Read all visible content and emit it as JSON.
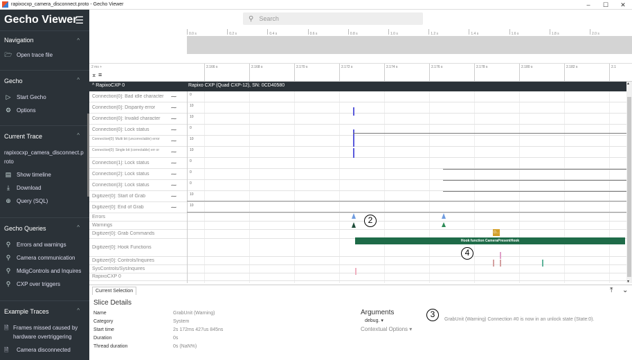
{
  "window": {
    "title": "rapixocxp_camera_disconnect.proto - Gecho Viewer",
    "minimize": "–",
    "maximize": "☐",
    "close": "✕"
  },
  "sidebar": {
    "brand": "Gecho Viewer",
    "sections": {
      "navigation": {
        "title": "Navigation",
        "items": [
          {
            "label": "Open trace file",
            "icon": "folder-icon"
          }
        ]
      },
      "gecho": {
        "title": "Gecho",
        "items": [
          {
            "label": "Start Gecho",
            "icon": "play-icon"
          },
          {
            "label": "Options",
            "icon": "gear-icon"
          }
        ]
      },
      "current_trace": {
        "title": "Current Trace",
        "file": "rapixocxp_camera_disconnect.proto",
        "items": [
          {
            "label": "Show timeline",
            "icon": "timeline-icon"
          },
          {
            "label": "Download",
            "icon": "download-icon"
          },
          {
            "label": "Query (SQL)",
            "icon": "query-icon"
          }
        ]
      },
      "gecho_queries": {
        "title": "Gecho Queries",
        "items": [
          {
            "label": "Errors and warnings"
          },
          {
            "label": "Camera communication"
          },
          {
            "label": "MdigControls and Inquires"
          },
          {
            "label": "CXP over triggers"
          }
        ]
      },
      "example_traces": {
        "title": "Example Traces",
        "items": [
          {
            "label": "Frames missed caused by hardware overtriggering"
          },
          {
            "label": "Camera disconnected"
          }
        ]
      }
    }
  },
  "search": {
    "placeholder": "Search"
  },
  "overview_ticks": [
    "0.0 s",
    "0.2 s",
    "0.4 s",
    "0.6 s",
    "0.8 s",
    "1.0 s",
    "1.2 s",
    "1.4 s",
    "1.6 s",
    "1.8 s",
    "2.0 s"
  ],
  "axis": {
    "zoom": "2 ms +",
    "ticks": [
      "2.166 s",
      "2.168 s",
      "2.170 s",
      "2.172 s",
      "2.174 s",
      "2.176 s",
      "2.178 s",
      "2.180 s",
      "2.182 s",
      "2.1"
    ]
  },
  "group": {
    "name": "RapixoCXP 0",
    "desc": "Rapixo CXP (Quad CXP-12), SN: 0CD40580"
  },
  "tracks": [
    {
      "label": "Connection[0]: Bad idle character",
      "value": "0"
    },
    {
      "label": "Connection[0]: Disparity error",
      "value": "10"
    },
    {
      "label": "Connection[0]: Invalid character",
      "value": "10"
    },
    {
      "label": "Connection[0]: Lock status",
      "value": "0"
    },
    {
      "label": "Connection[0]: Multi bit (uncorrectable) error",
      "value": "10"
    },
    {
      "label": "Connection[0]: Single bit (correctable) err or",
      "value": "10"
    },
    {
      "label": "Connection[1]: Lock status",
      "value": "0"
    },
    {
      "label": "Connection[2]: Lock status",
      "value": "0"
    },
    {
      "label": "Connection[3]: Lock status",
      "value": "0"
    },
    {
      "label": "Digitizer[0]: Start of Grab",
      "value": "10"
    },
    {
      "label": "Digitizer[0]: End of Grab",
      "value": "10"
    },
    {
      "label": "Errors"
    },
    {
      "label": "Warnings"
    },
    {
      "label": "Digitizer[0]: Grab Commands"
    },
    {
      "label": "Digitizer[0]: Hook Functions"
    },
    {
      "label": "Digitizer[0]: Controls/Inquires"
    },
    {
      "label": "SysControls/SysInquires"
    },
    {
      "label": "RapixoCXP 0"
    }
  ],
  "grab_marker": "D...",
  "hook_slice": "Hook function CameraPresentHook",
  "callouts": [
    "2",
    "3",
    "4"
  ],
  "bottom": {
    "tab": "Current Selection",
    "heading": "Slice Details",
    "details": [
      {
        "k": "Name",
        "v": "GrabUnit (Warning)"
      },
      {
        "k": "Category",
        "v": "System"
      },
      {
        "k": "Start time",
        "v": "2s 172ms 427us 845ns"
      },
      {
        "k": "Duration",
        "v": "0s"
      },
      {
        "k": "Thread duration",
        "v": "0s (NaN%)"
      }
    ],
    "arguments_title": "Arguments",
    "arguments_select": "debug. ▾",
    "contextual": "Contextual Options ▾",
    "argument_value": "GrabUnit (Warning) Connection #0 is now in an unlock state (State:0)."
  },
  "colors": {
    "sidebar": "#2b3238",
    "hook": "#1e6b48",
    "spike": "#5a5adb",
    "marker": "#d4a02a"
  }
}
